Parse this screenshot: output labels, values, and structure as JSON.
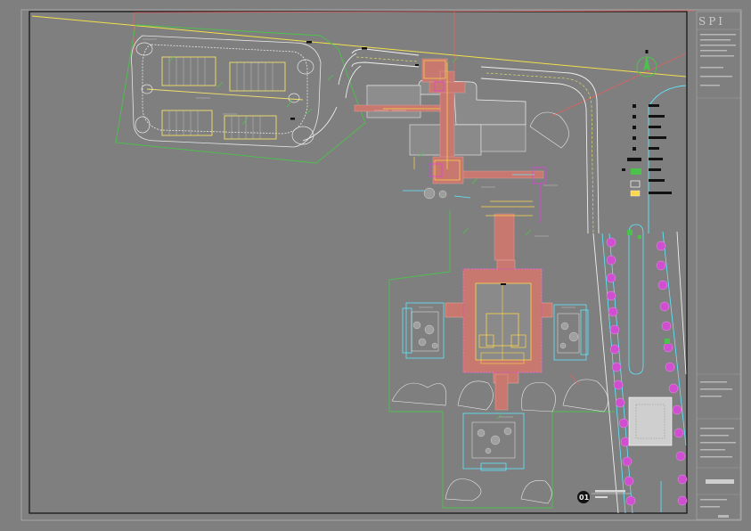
{
  "titleblock": {
    "logo": "SPI",
    "drawing_number": "01"
  },
  "colors": {
    "background": "#7f7f7f",
    "frame": "#a6a6a6",
    "boundary": "#4cc24c",
    "paving": "#c8786e",
    "road": "#eeeeee",
    "building": "#8a8a8a",
    "highlight": "#ffd84a",
    "magenta": "#e040e0",
    "cyan": "#5fe8ff",
    "red_line": "#e06060"
  },
  "legend": {
    "items": [
      "",
      "",
      "",
      "",
      "",
      "",
      "",
      "",
      "",
      ""
    ]
  },
  "icons": [
    "north-arrow-icon",
    "section-marker-icon"
  ]
}
